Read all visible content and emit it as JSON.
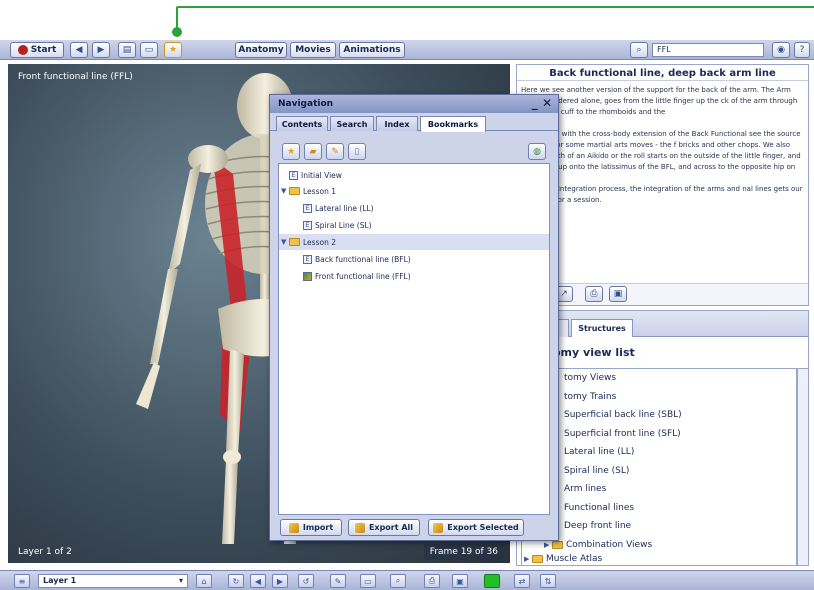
{
  "toolbar": {
    "start_label": "Start",
    "anatomy_label": "Anatomy",
    "movies_label": "Movies",
    "animations_label": "Animations",
    "search_value": "FFL"
  },
  "viewport": {
    "title": "Front functional line (FFL)",
    "layer_status": "Layer 1 of 2",
    "frame_status": "Frame 19 of 36"
  },
  "info": {
    "title": "Back functional line, deep back arm line",
    "paragraphs": [
      "Here we see another version of the support for the back of the arm. The Arm Line, considered alone, goes from the little finger up the ck of the arm through the rotator cuff to the rhomboids and the",
      "considered with the cross-body extension of the Back Functional see the source of power for some martial arts moves - the f bricks and other chops. We also see the path of an Aikido or the roll starts on the outside of the little finger, and passes on up onto the latissimus of the BFL, and across to the opposite hip on",
      "Structural Integration process, the integration of the arms and nal lines gets our attention for a session."
    ]
  },
  "lower_panel": {
    "structures_tab": "Structures",
    "list_title": "omy view list",
    "items": [
      "tomy Views",
      "tomy Trains",
      "Superficial back line (SBL)",
      "Superficial front line (SFL)",
      "Lateral line (LL)",
      "Spiral line (SL)",
      "Arm lines",
      "Functional lines",
      "Deep front line",
      "Combination Views",
      "Muscle Atlas"
    ]
  },
  "navigation": {
    "title": "Navigation",
    "tabs": [
      "Contents",
      "Search",
      "Index",
      "Bookmarks"
    ],
    "tree": {
      "initial_view": "Initial View",
      "lesson1": "Lesson 1",
      "lateral_line": "Lateral line (LL)",
      "spiral_line": "Spiral Line (SL)",
      "lesson2": "Lesson 2",
      "back_functional": "Back functional line (BFL)",
      "front_functional": "Front functional line (FFL)"
    },
    "import_label": "Import",
    "export_all_label": "Export All",
    "export_selected_label": "Export Selected"
  },
  "bottombar": {
    "layer_value": "Layer 1"
  },
  "colors": {
    "callout": "#2aa33a",
    "toolbar": "#aab4d6",
    "dialog": "#cdd4ea",
    "muscle": "#c8242a"
  }
}
